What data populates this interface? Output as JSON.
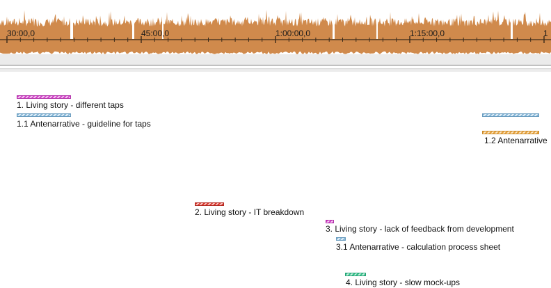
{
  "timeline": {
    "ticks": [
      "30:00,0",
      "45:00,0",
      "1:00:00,0",
      "1:15:00,0",
      "1"
    ],
    "waveform_color": "#d08a4c",
    "track_color": "#ebebeb"
  },
  "codes": [
    {
      "label": "1. Living story - different taps",
      "color": "magenta"
    },
    {
      "label": "1.1 Antenarrative - guideline for taps",
      "color": "blue"
    },
    {
      "label": "",
      "color": "blue"
    },
    {
      "label": "1.2 Antenarrative",
      "color": "orange"
    },
    {
      "label": "2. Living story - IT breakdown",
      "color": "red"
    },
    {
      "label": "3. Living story - lack of feedback from development",
      "color": "magenta"
    },
    {
      "label": "3.1 Antenarrative - calculation process sheet",
      "color": "blue"
    },
    {
      "label": "4. Living story - slow mock-ups",
      "color": "green"
    }
  ]
}
